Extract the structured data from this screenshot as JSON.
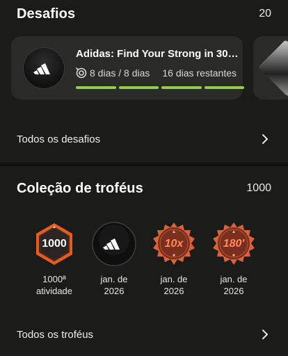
{
  "challenges": {
    "title": "Desafios",
    "count": "20",
    "card": {
      "title": "Adidas: Find Your Strong in 30 ...",
      "progress": "8 dias / 8 dias",
      "remaining": "16 dias restantes",
      "progress_fraction": 1.0,
      "segments": 4,
      "bar_color": "#8fd14f"
    },
    "all_link": "Todos os desafios"
  },
  "trophies": {
    "title": "Coleção de troféus",
    "count": "1000",
    "items": [
      {
        "badge": "1000",
        "label_line1": "1000ª",
        "label_line2": "atividade",
        "icon": "hexagon-1000-badge-icon"
      },
      {
        "badge": "",
        "label_line1": "jan. de",
        "label_line2": "2026",
        "icon": "adidas-logo-badge-icon"
      },
      {
        "badge": "10x",
        "label_line1": "jan. de",
        "label_line2": "2026",
        "icon": "seal-10x-badge-icon"
      },
      {
        "badge": "180'",
        "label_line1": "jan. de",
        "label_line2": "2026",
        "icon": "seal-180-badge-icon"
      }
    ],
    "all_link": "Todos os troféus"
  },
  "colors": {
    "background": "#1b1b19",
    "card": "#2a2a27",
    "accent_green": "#8fd14f",
    "badge_orange": "#e85a1e",
    "seal_red": "#7a2e1e"
  }
}
